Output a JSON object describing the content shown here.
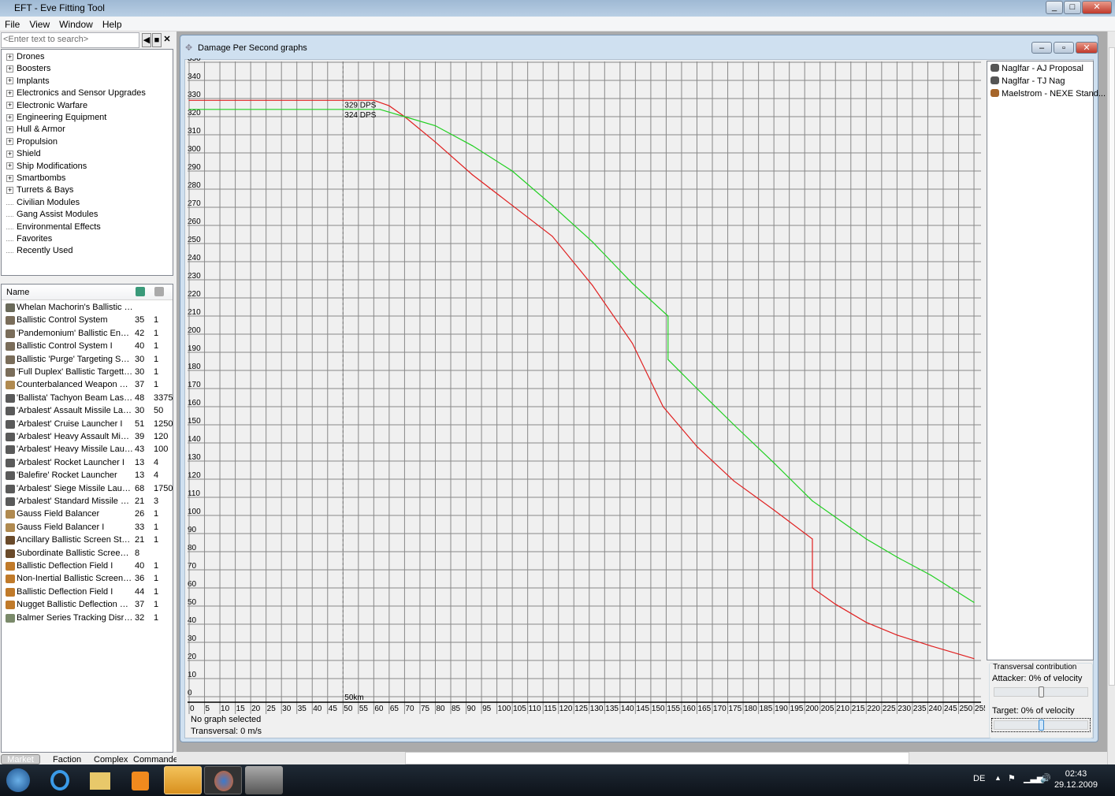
{
  "window": {
    "title": "EFT - Eve Fitting Tool",
    "min": "_",
    "max": "□",
    "close": "✕"
  },
  "menu": [
    "File",
    "View",
    "Window",
    "Help"
  ],
  "search": {
    "placeholder": "<Enter text to search>"
  },
  "tree": [
    {
      "label": "Drones",
      "expand": true
    },
    {
      "label": "Boosters",
      "expand": true
    },
    {
      "label": "Implants",
      "expand": true
    },
    {
      "label": "Electronics and Sensor Upgrades",
      "expand": true
    },
    {
      "label": "Electronic Warfare",
      "expand": true
    },
    {
      "label": "Engineering Equipment",
      "expand": true
    },
    {
      "label": "Hull & Armor",
      "expand": true
    },
    {
      "label": "Propulsion",
      "expand": true
    },
    {
      "label": "Shield",
      "expand": true
    },
    {
      "label": "Ship Modifications",
      "expand": true
    },
    {
      "label": "Smartbombs",
      "expand": true
    },
    {
      "label": "Turrets & Bays",
      "expand": true
    },
    {
      "label": "Civilian Modules",
      "expand": false
    },
    {
      "label": "Gang Assist Modules",
      "expand": false
    },
    {
      "label": "Environmental Effects",
      "expand": false
    },
    {
      "label": "Favorites",
      "expand": false
    },
    {
      "label": "Recently Used",
      "expand": false
    }
  ],
  "items": {
    "header": "Name",
    "rows": [
      [
        "Whelan Machorin's Ballistic Smartl...",
        "",
        ""
      ],
      [
        "Ballistic Control System",
        "35",
        "1"
      ],
      [
        "'Pandemonium' Ballistic Enhance...",
        "42",
        "1"
      ],
      [
        "Ballistic Control System I",
        "40",
        "1"
      ],
      [
        "Ballistic 'Purge' Targeting System I",
        "30",
        "1"
      ],
      [
        "'Full Duplex' Ballistic Targetting Sy...",
        "30",
        "1"
      ],
      [
        "Counterbalanced Weapon Mounts I",
        "37",
        "1"
      ],
      [
        "'Ballista' Tachyon Beam Laser I",
        "48",
        "3375"
      ],
      [
        "'Arbalest' Assault Missile Launcher",
        "30",
        "50"
      ],
      [
        "'Arbalest' Cruise Launcher I",
        "51",
        "1250"
      ],
      [
        "'Arbalest' Heavy Assault Missile L...",
        "39",
        "120"
      ],
      [
        "'Arbalest' Heavy Missile Launcher",
        "43",
        "100"
      ],
      [
        "'Arbalest' Rocket Launcher I",
        "13",
        "4"
      ],
      [
        "'Balefire' Rocket Launcher",
        "13",
        "4"
      ],
      [
        "'Arbalest' Siege Missile Launcher",
        "68",
        "1750"
      ],
      [
        "'Arbalest' Standard Missile Launcher",
        "21",
        "3"
      ],
      [
        "Gauss Field Balancer",
        "26",
        "1"
      ],
      [
        "Gauss Field Balancer I",
        "33",
        "1"
      ],
      [
        "Ancillary Ballistic Screen Stabilizer",
        "21",
        "1"
      ],
      [
        "Subordinate Ballistic Screen Stabil...",
        "8",
        ""
      ],
      [
        "Ballistic Deflection Field I",
        "40",
        "1"
      ],
      [
        "Non-Inertial Ballistic Screen Augm...",
        "36",
        "1"
      ],
      [
        "Ballistic Deflection Field I",
        "44",
        "1"
      ],
      [
        "Nugget Ballistic Deflection Field",
        "37",
        "1"
      ],
      [
        "Balmer Series Tracking Disruptor I",
        "32",
        "1"
      ]
    ]
  },
  "bottom_tabs": [
    "Market",
    "Faction",
    "Complex",
    "Commander"
  ],
  "graph_window": {
    "title": "Damage Per Second graphs"
  },
  "legend": [
    "Naglfar - AJ Proposal",
    "Naglfar - TJ Nag",
    "Maelstrom - NEXE Stand..."
  ],
  "transversal": {
    "title": "Transversal contribution",
    "attacker": "Attacker: 0% of velocity",
    "target": "Target: 0% of velocity",
    "attacker_value": 0,
    "target_value": 0
  },
  "status": {
    "line1": "No graph selected",
    "line2": "Transversal: 0 m/s"
  },
  "clock": {
    "time": "02:43",
    "date": "29.12.2009",
    "lang": "DE"
  },
  "chart_data": {
    "type": "line",
    "title": "Damage Per Second graphs",
    "xlabel": "km",
    "ylabel": "DPS",
    "xlim": [
      0,
      257.5
    ],
    "ylim": [
      0,
      350
    ],
    "xtick_step": 5,
    "ytick_step": 10,
    "grid": true,
    "marker": {
      "x": 50,
      "label": "50km"
    },
    "series": [
      {
        "name": "Naglfar - AJ Proposal",
        "color": "#e02020",
        "label": "329 DPS",
        "x": [
          0,
          60,
          65,
          70,
          80,
          92,
          105,
          118,
          131,
          144,
          154,
          165,
          177,
          190,
          202.5,
          202.5,
          210,
          220,
          230,
          241,
          255
        ],
        "y": [
          329,
          329,
          326,
          320,
          306,
          288,
          271,
          254,
          227,
          195,
          160,
          138,
          119,
          103,
          87,
          60,
          51,
          41,
          34,
          28,
          21
        ]
      },
      {
        "name": "Naglfar - TJ Nag",
        "color": "#20d020",
        "label": "324 DPS",
        "x": [
          0,
          62,
          70,
          80,
          92,
          105,
          118,
          131,
          144,
          155.6,
          155.6,
          165,
          177,
          190,
          202.5,
          210,
          220,
          230,
          241,
          255
        ],
        "y": [
          324,
          324,
          320,
          315,
          304,
          290,
          271,
          251,
          228,
          210,
          186,
          170,
          150,
          129,
          108,
          99,
          87,
          77,
          67,
          52
        ]
      }
    ]
  }
}
